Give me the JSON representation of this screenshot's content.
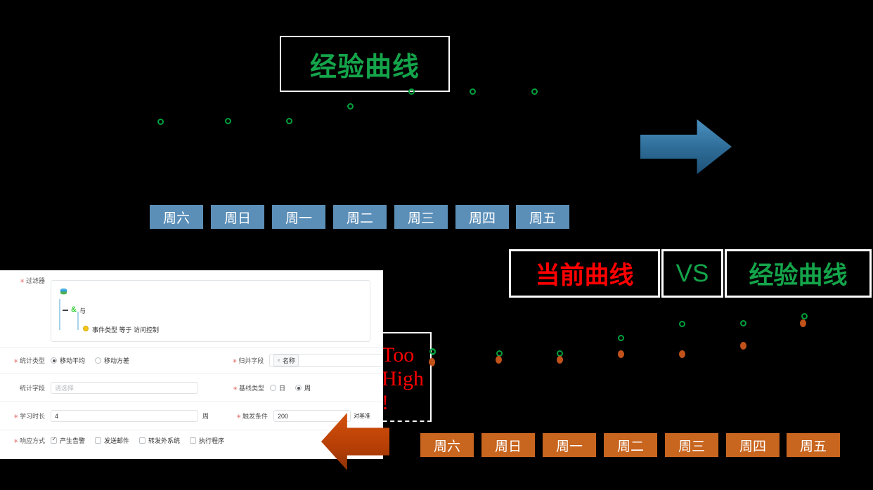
{
  "title_box": {
    "text": "经验曲线",
    "color": "#14A44A"
  },
  "arrows": {
    "blue": {
      "name": "blue-right-arrow",
      "color": "#2d6b96"
    },
    "orange": {
      "name": "orange-left-arrow",
      "color": "#b63f06"
    }
  },
  "top_week_labels": [
    "周六",
    "周日",
    "周一",
    "周二",
    "周三",
    "周四",
    "周五"
  ],
  "bottom_week_labels": [
    "周六",
    "周日",
    "周一",
    "周二",
    "周三",
    "周四",
    "周五"
  ],
  "banner": {
    "current_curve": "当前曲线",
    "vs": "VS",
    "experience_curve": "经验曲线",
    "current_color": "#FF0000",
    "experience_color": "#14A44A"
  },
  "callout": {
    "line1": "Too",
    "line2": "High !",
    "color": "#FF0000"
  },
  "form": {
    "filter": {
      "label": "过滤器",
      "root_icon": "database-icon",
      "and_node": "与",
      "and_icon": "ampersand-icon",
      "condition_icon": "yellow-dot-icon",
      "condition": "事件类型 等于 访问控制"
    },
    "stat_type": {
      "label": "统计类型",
      "options": [
        "移动平均",
        "移动方差"
      ],
      "selected": "移动平均"
    },
    "merge_field": {
      "label": "归并字段",
      "tag": "名称"
    },
    "stat_field": {
      "label": "统计字段",
      "placeholder": "请选择",
      "value": ""
    },
    "baseline_type": {
      "label": "基线类型",
      "options": [
        "日",
        "周"
      ],
      "selected": "周"
    },
    "learn_duration": {
      "label": "学习时长",
      "value": "4",
      "unit": "周"
    },
    "trigger_condition": {
      "label": "触发条件",
      "value": "200",
      "suffix": "对基准"
    },
    "response_mode": {
      "label": "响应方式",
      "options": [
        {
          "label": "产生告警",
          "checked": true
        },
        {
          "label": "发送邮件",
          "checked": false
        },
        {
          "label": "转发外系统",
          "checked": false
        },
        {
          "label": "执行程序",
          "checked": false
        }
      ]
    }
  },
  "chart_data": [
    {
      "type": "scatter",
      "title": "经验曲线",
      "categories": [
        "周六",
        "周日",
        "周一",
        "周二",
        "周三",
        "周四",
        "周五"
      ],
      "series": [
        {
          "name": "经验曲线",
          "color": "#00a03c",
          "values": [
            20,
            21,
            21,
            42,
            62,
            62,
            62
          ]
        }
      ],
      "xlabel": "",
      "ylabel": "",
      "grid": false,
      "legend": "none"
    },
    {
      "type": "scatter",
      "title": "当前曲线 VS 经验曲线",
      "categories": [
        "周六",
        "周日",
        "周一",
        "周二",
        "周三",
        "周四",
        "周五"
      ],
      "series": [
        {
          "name": "经验曲线",
          "color": "#00a03c",
          "values": [
            22,
            20,
            20,
            42,
            62,
            63,
            73
          ]
        },
        {
          "name": "当前曲线",
          "color": "#c1521a",
          "values": [
            8,
            12,
            12,
            20,
            20,
            32,
            64
          ]
        }
      ],
      "xlabel": "",
      "ylabel": "",
      "grid": false,
      "legend": "none"
    }
  ]
}
